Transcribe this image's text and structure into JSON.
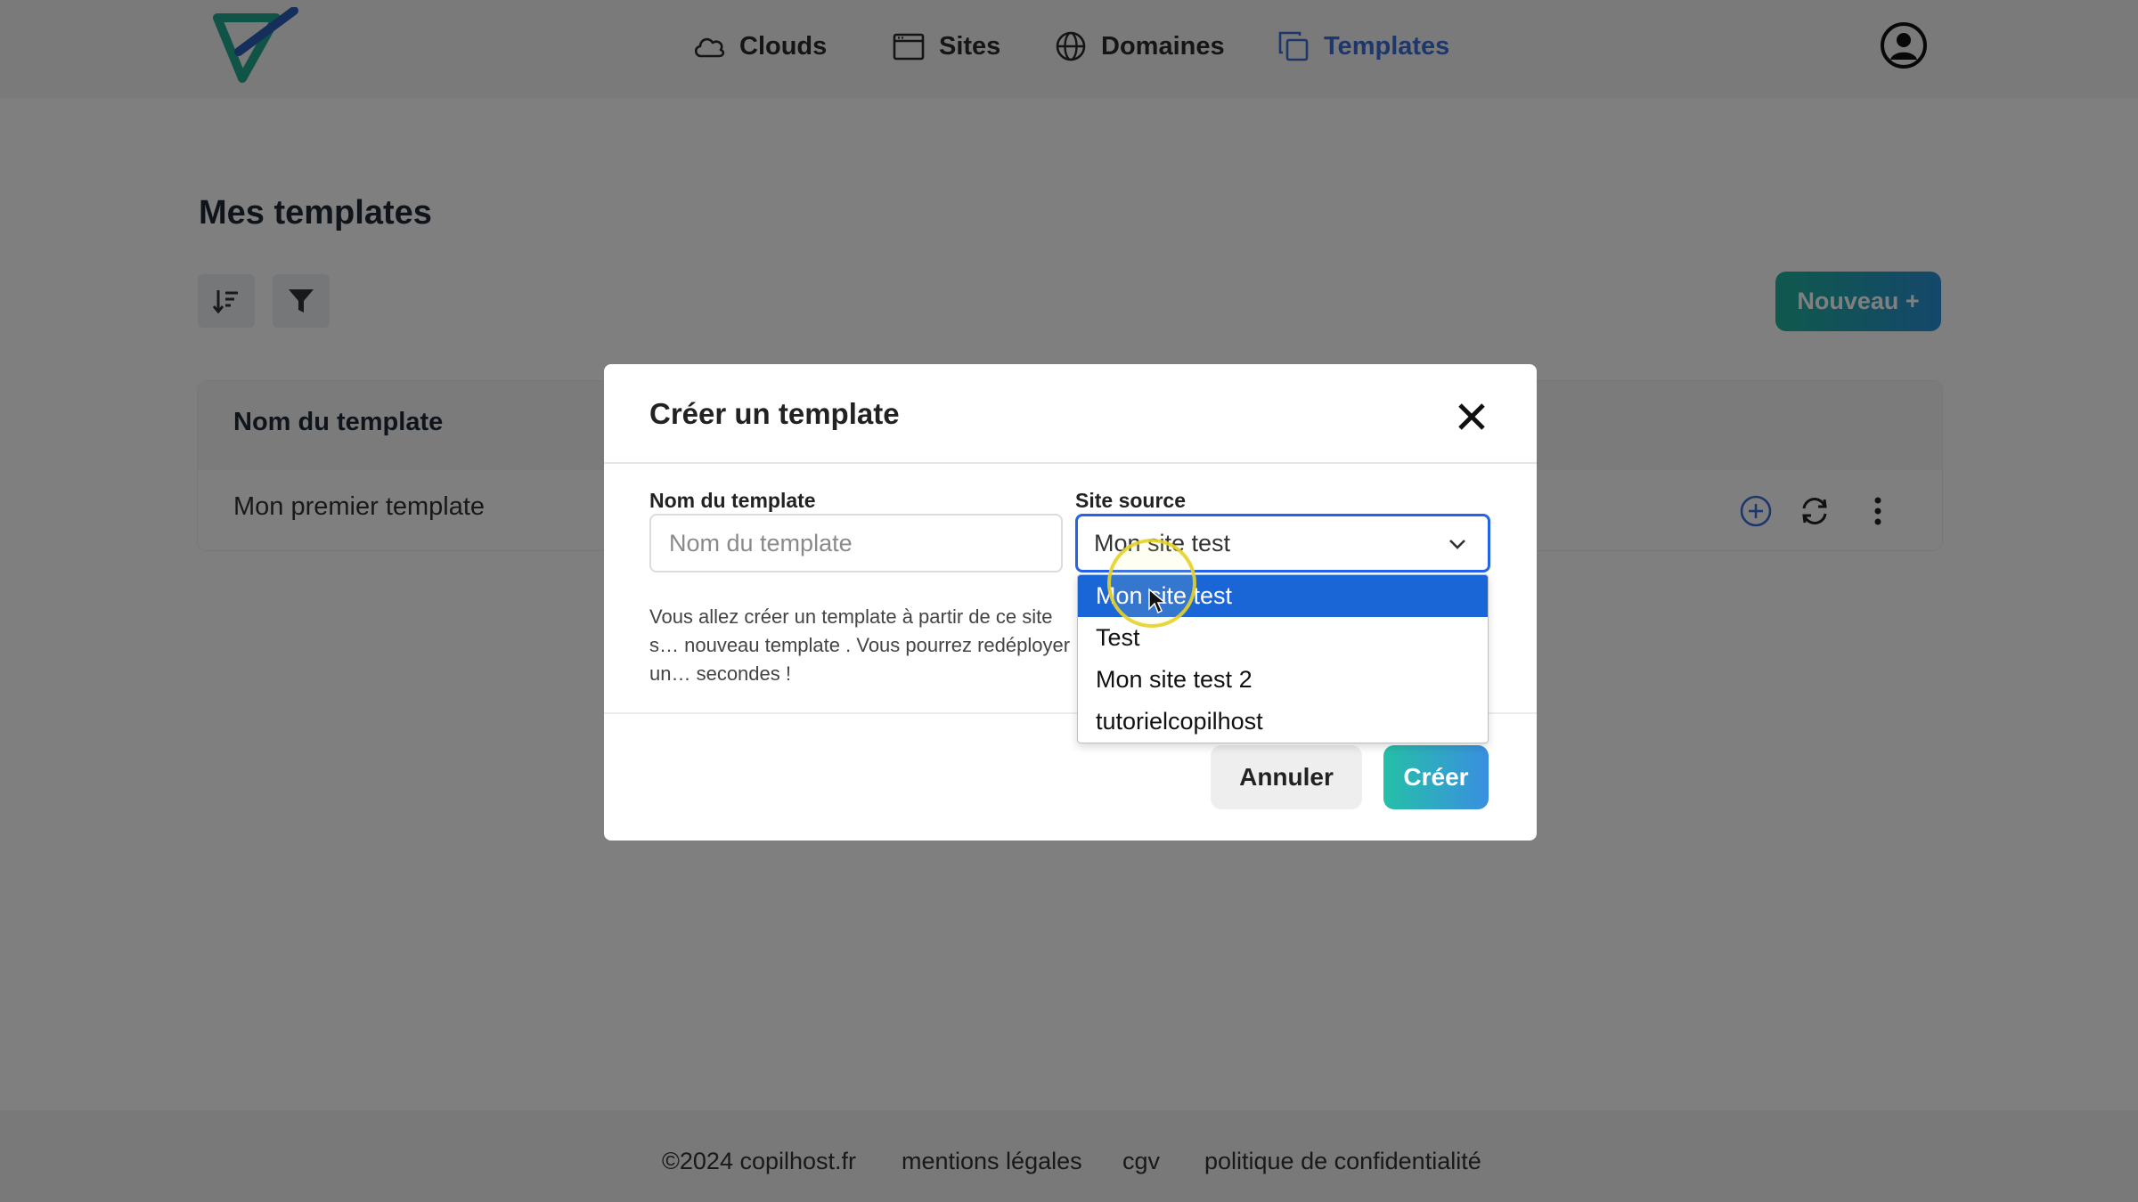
{
  "header": {
    "nav": [
      {
        "label": "Clouds",
        "icon": "cloud-icon"
      },
      {
        "label": "Sites",
        "icon": "browser-window-icon"
      },
      {
        "label": "Domaines",
        "icon": "globe-icon"
      },
      {
        "label": "Templates",
        "icon": "copy-icon",
        "active": true
      }
    ],
    "accent_color": "#3b6fd8"
  },
  "main": {
    "title": "Mes templates",
    "new_button": "Nouveau +",
    "table": {
      "column_name": "Nom du template",
      "rows": [
        {
          "name": "Mon premier template"
        }
      ]
    }
  },
  "modal": {
    "title": "Créer un template",
    "name_label": "Nom du template",
    "name_placeholder": "Nom du template",
    "name_value": "",
    "site_label": "Site source",
    "site_selected": "Mon site test",
    "site_options": [
      "Mon site test",
      "Test",
      "Mon site test 2",
      "tutorielcopilhost"
    ],
    "helper_text": "Vous allez créer un template à partir de ce site s… nouveau template . Vous pourrez redéployer un… secondes !",
    "cancel_label": "Annuler",
    "create_label": "Créer"
  },
  "footer": {
    "copyright": "©2024 copilhost.fr",
    "legal": "mentions légales",
    "cgv": "cgv",
    "privacy": "politique de confidentialité"
  }
}
